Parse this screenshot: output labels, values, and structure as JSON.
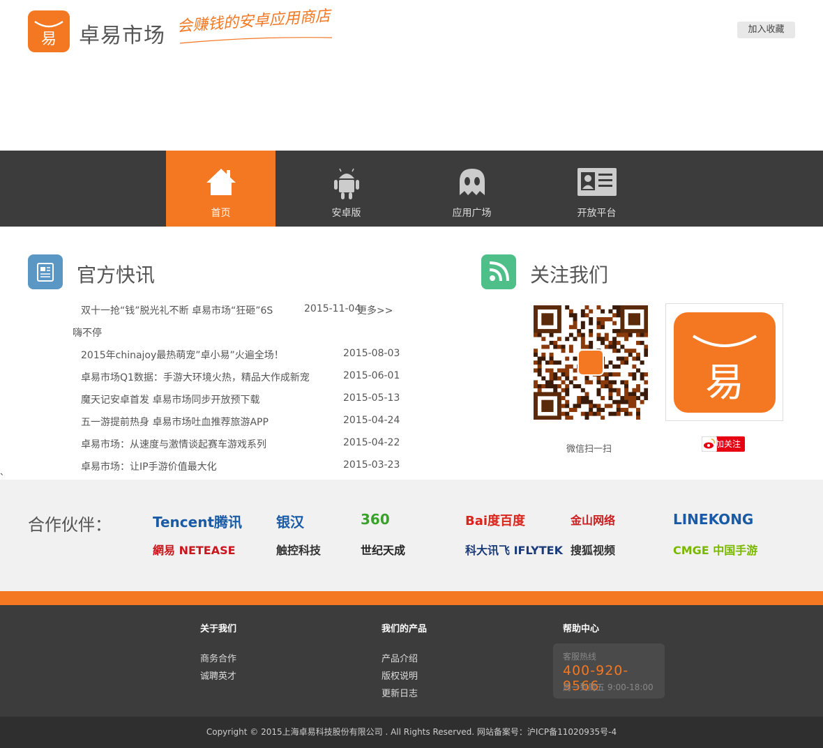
{
  "header": {
    "brand": "卓易市场",
    "slogan": "会赚钱的安卓应用商店",
    "favorite_button": "加入收藏"
  },
  "nav": {
    "items": [
      {
        "label": "首页",
        "icon": "home-icon",
        "active": true
      },
      {
        "label": "安卓版",
        "icon": "android-icon",
        "active": false
      },
      {
        "label": "应用广场",
        "icon": "ghost-icon",
        "active": false
      },
      {
        "label": "开放平台",
        "icon": "id-card-icon",
        "active": false
      }
    ]
  },
  "news": {
    "title": "官方快讯",
    "items": [
      {
        "title": "双十一抢“钱”脱光礼不断 卓易市场“狂砸”6S",
        "date": "2015-11-04",
        "more": "更多>>",
        "wrap": "嗨不停"
      },
      {
        "title": "2015年chinajoy最热萌宠”卓小易”火遍全场！",
        "date": "2015-08-03"
      },
      {
        "title": "卓易市场Q1数据：手游大环境火热，精品大作成新宠",
        "date": "2015-06-01"
      },
      {
        "title": "魔天记安卓首发 卓易市场同步开放预下载",
        "date": "2015-05-13"
      },
      {
        "title": "五一游提前热身 卓易市场吐血推荐旅游APP",
        "date": "2015-04-24"
      },
      {
        "title": "卓易市场：从速度与激情谈起赛车游戏系列",
        "date": "2015-04-22"
      },
      {
        "title": "卓易市场：让IP手游价值最大化",
        "date": "2015-03-23"
      }
    ],
    "stray": "、"
  },
  "follow": {
    "title": "关注我们",
    "wechat_label": "微信扫一扫",
    "weibo_button": "加关注"
  },
  "partners": {
    "title": "合作伙伴：",
    "row1": [
      {
        "name": "Tencent腾讯",
        "color": "#1a5ba6"
      },
      {
        "name": "银汉",
        "color": "#1a5ba6"
      },
      {
        "name": "360",
        "color": "#3aa12d"
      },
      {
        "name": "Bai度百度",
        "color": "#d9261c"
      },
      {
        "name": "金山网络",
        "color": "#cc1c1c"
      },
      {
        "name": "LINEKONG",
        "color": "#1a5ba6"
      }
    ],
    "row2": [
      {
        "name": "網易 NETEASE",
        "color": "#c8161d"
      },
      {
        "name": "触控科技",
        "color": "#333333"
      },
      {
        "name": "世纪天成",
        "color": "#222222"
      },
      {
        "name": "科大讯飞 IFLYTEK",
        "color": "#1a3a7a"
      },
      {
        "name": "搜狐视频",
        "color": "#333333"
      },
      {
        "name": "CMGE 中国手游",
        "color": "#7ab800"
      }
    ]
  },
  "footer": {
    "about": {
      "title": "关于我们",
      "links": [
        "商务合作",
        "诚聘英才"
      ]
    },
    "products": {
      "title": "我们的产品",
      "links": [
        "产品介绍",
        "版权说明",
        "更新日志"
      ]
    },
    "help": {
      "title": "帮助中心",
      "hotline_label": "客服热线",
      "hotline_number": "400-920-9566",
      "hours": "周一到周五 9:00-18:00"
    },
    "copyright": "Copyright © 2015上海卓易科技股份有限公司 . All Rights Reserved. 网站备案号：沪ICP备11020935号-4"
  },
  "colors": {
    "accent": "#f47721",
    "nav_bg": "#3c3c3c",
    "news_icon": "#5b97c4",
    "follow_icon": "#4fbf8a"
  }
}
